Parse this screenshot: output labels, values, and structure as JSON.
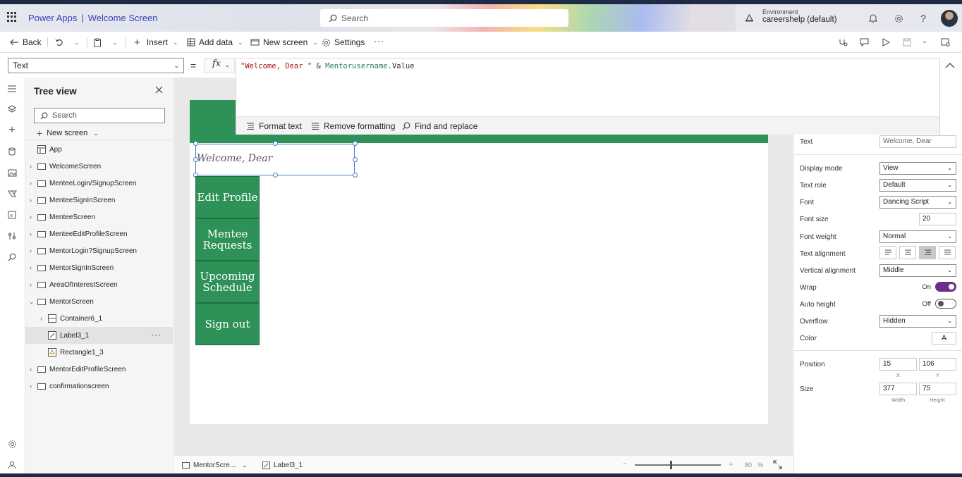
{
  "header": {
    "app_name": "Power Apps",
    "separator": "|",
    "screen_name": "Welcome Screen",
    "search_placeholder": "Search",
    "environment_label": "Environment",
    "environment_value": "careershelp (default)"
  },
  "commandbar": {
    "back": "Back",
    "insert": "Insert",
    "add_data": "Add data",
    "new_screen": "New screen",
    "settings": "Settings",
    "more": "···"
  },
  "formula": {
    "property": "Text",
    "fx": "fx",
    "string_part": "\"Welcome, Dear \"",
    "operator": " & ",
    "reference": "Mentorusername",
    "suffix": ".Value",
    "tools": {
      "format": "Format text",
      "remove": "Remove formatting",
      "find": "Find and replace"
    }
  },
  "tree": {
    "title": "Tree view",
    "search_placeholder": "Search",
    "new_screen": "New screen",
    "app_label": "App",
    "items": [
      {
        "label": "WelcomeScreen"
      },
      {
        "label": "MenteeLogin/SignupScreen"
      },
      {
        "label": "MenteeSignInScreen"
      },
      {
        "label": "MenteeScreen"
      },
      {
        "label": "MenteeEditProfileScreen"
      },
      {
        "label": "MentorLogin?SignupScreen"
      },
      {
        "label": "MentorSignInScreen"
      },
      {
        "label": "AreaOfInterestScreen"
      },
      {
        "label": "MentorScreen"
      },
      {
        "label": "Container6_1"
      },
      {
        "label": "Label3_1"
      },
      {
        "label": "Rectangle1_3"
      },
      {
        "label": "MentorEditProfileScreen"
      },
      {
        "label": "confirmationscreen"
      }
    ],
    "more": "···"
  },
  "canvas": {
    "label_text": "Welcome, Dear",
    "buttons": [
      "Edit Profile",
      "Mentee Requests",
      "Upcoming Schedule",
      "Sign out"
    ],
    "accent_color": "#2e9157"
  },
  "statusbar": {
    "screen": "MentorScre...",
    "control": "Label3_1",
    "zoom_minus": "−",
    "zoom_plus": "+",
    "zoom": "80",
    "zoom_unit": "%"
  },
  "properties": {
    "text_label": "Text",
    "text_value": "Welcome, Dear",
    "display_mode_label": "Display mode",
    "display_mode": "View",
    "text_role_label": "Text role",
    "text_role": "Default",
    "font_label": "Font",
    "font": "Dancing Script",
    "font_size_label": "Font size",
    "font_size": "20",
    "font_weight_label": "Font weight",
    "font_weight": "Normal",
    "text_alignment_label": "Text alignment",
    "vertical_alignment_label": "Vertical alignment",
    "vertical_alignment": "Middle",
    "wrap_label": "Wrap",
    "wrap_state": "On",
    "auto_height_label": "Auto height",
    "auto_height_state": "Off",
    "overflow_label": "Overflow",
    "overflow": "Hidden",
    "color_label": "Color",
    "color_button": "A",
    "position_label": "Position",
    "x": "15",
    "y": "106",
    "x_label": "X",
    "y_label": "Y",
    "size_label": "Size",
    "width": "377",
    "height": "75",
    "width_label": "Width",
    "height_label": "Height",
    "toggle_color": "#6b2d8b"
  }
}
